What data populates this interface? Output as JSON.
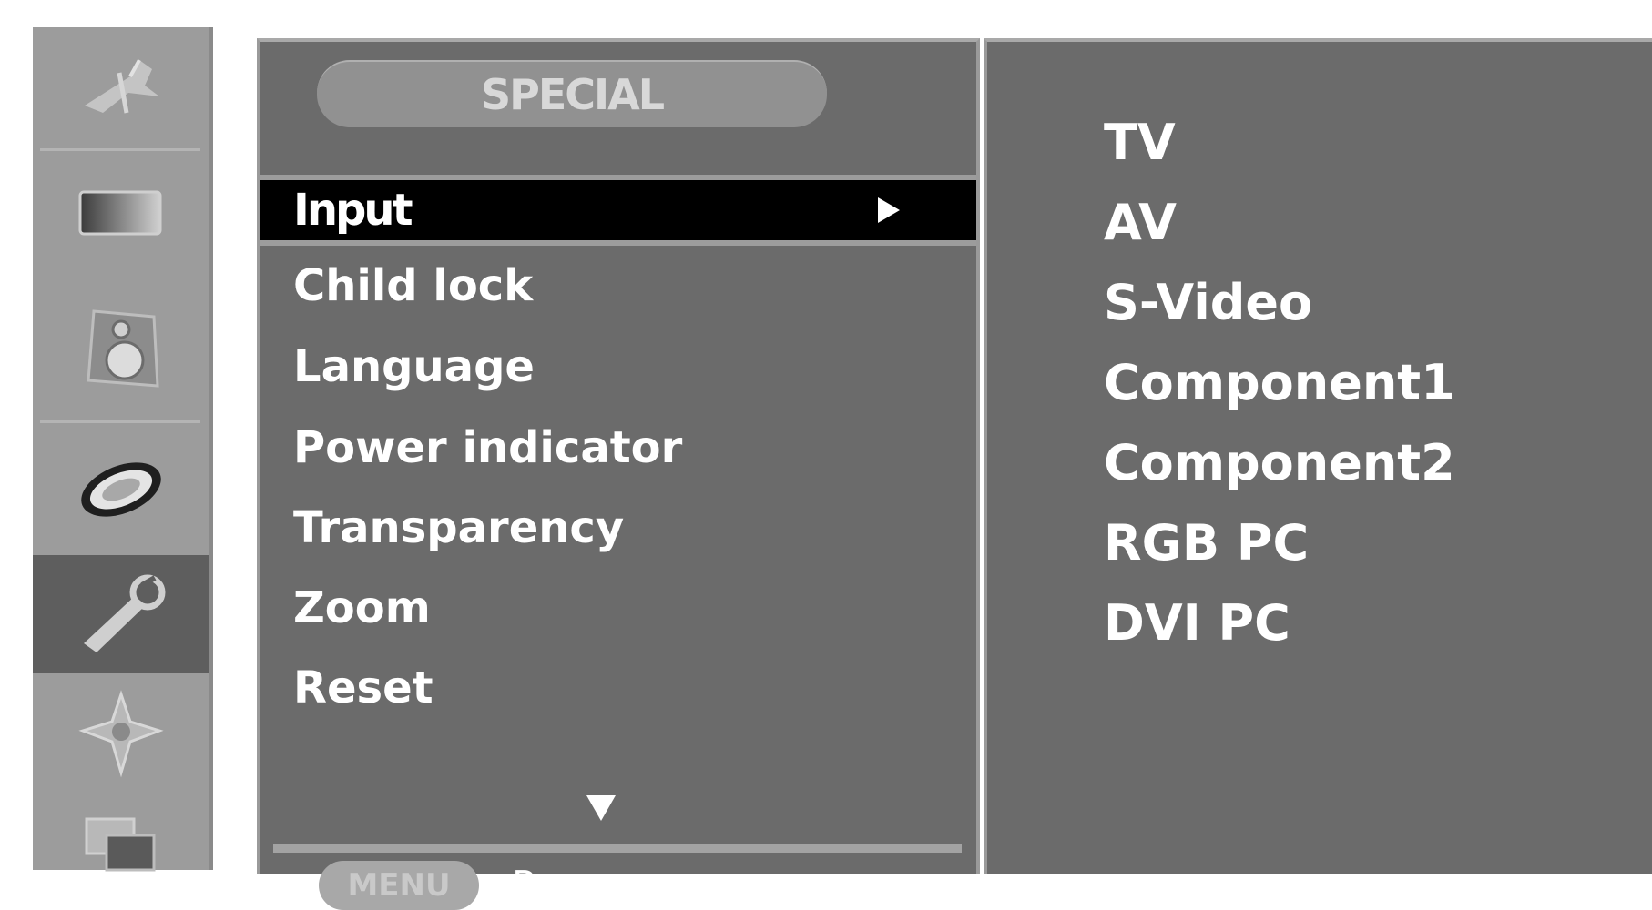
{
  "menu": {
    "title": "SPECIAL",
    "items": [
      {
        "label": "Input",
        "selected": true
      },
      {
        "label": "Child lock"
      },
      {
        "label": "Language"
      },
      {
        "label": "Power indicator"
      },
      {
        "label": "Transparency"
      },
      {
        "label": "Zoom"
      },
      {
        "label": "Reset"
      }
    ],
    "footer": {
      "key_label": "MENU",
      "action_label": "Prev."
    }
  },
  "sidebar": {
    "icons": [
      "station-icon",
      "picture-icon",
      "sound-icon",
      "time-icon",
      "special-icon",
      "screen-icon",
      "pip-icon"
    ],
    "active_index": 4
  },
  "submenu": {
    "items": [
      "TV",
      "AV",
      "S-Video",
      "Component1",
      "Component2",
      "RGB PC",
      "DVI PC"
    ]
  }
}
